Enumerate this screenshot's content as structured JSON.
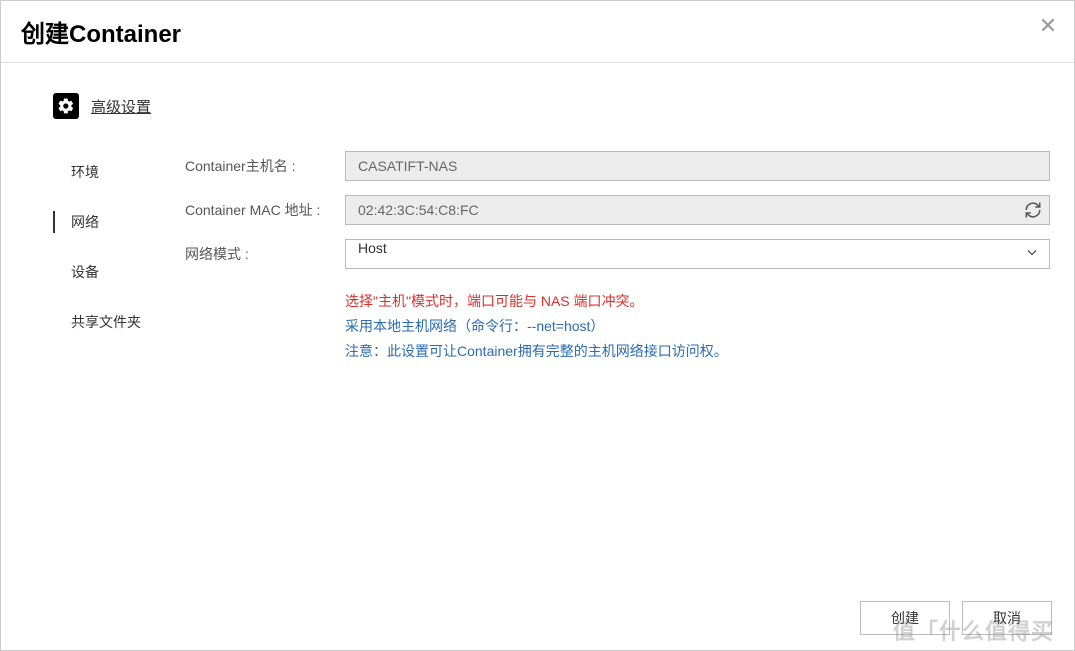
{
  "dialog": {
    "title": "创建Container",
    "section_title": "高级设置"
  },
  "sidebar": {
    "items": [
      {
        "label": "环境",
        "active": false
      },
      {
        "label": "网络",
        "active": true
      },
      {
        "label": "设备",
        "active": false
      },
      {
        "label": "共享文件夹",
        "active": false
      }
    ]
  },
  "form": {
    "hostname_label": "Container主机名 :",
    "hostname_value": "CASATIFT-NAS",
    "mac_label": "Container MAC 地址 :",
    "mac_value": "02:42:3C:54:C8:FC",
    "mode_label": "网络模式 :",
    "mode_value": "Host"
  },
  "info": {
    "warning": "选择\"主机\"模式时，端口可能与 NAS 端口冲突。",
    "line1": "采用本地主机网络（命令行：--net=host）",
    "line2": "注意：此设置可让Container拥有完整的主机网络接口访问权。"
  },
  "footer": {
    "create": "创建",
    "cancel": "取消"
  },
  "watermark": "值「什么值得买"
}
